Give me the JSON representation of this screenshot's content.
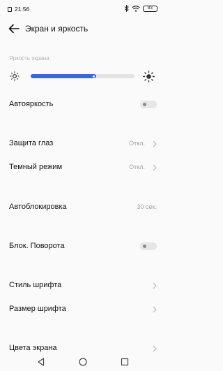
{
  "status_bar": {
    "time": "21:56",
    "battery": "83",
    "icons": [
      "bluetooth-icon",
      "wifi-icon",
      "battery-icon"
    ]
  },
  "header": {
    "title": "Экран и яркость",
    "back_icon": "arrow-left-icon"
  },
  "brightness": {
    "section_label": "Яркость экрана",
    "level_percent": 63,
    "accent_color": "#3b63e6"
  },
  "settings": {
    "auto_brightness": {
      "label": "Автояркость",
      "enabled": false
    },
    "eye_protection": {
      "label": "Защита глаз",
      "value": "Откл."
    },
    "dark_mode": {
      "label": "Темный режим",
      "value": "Откл."
    },
    "auto_lock": {
      "label": "Автоблокировка",
      "value": "30 сек."
    },
    "rotation_lock": {
      "label": "Блок. Поворота",
      "enabled": false
    },
    "font_style": {
      "label": "Стиль шрифта"
    },
    "font_size": {
      "label": "Размер шрифта"
    },
    "screen_colors": {
      "label": "Цвета экрана"
    }
  },
  "nav_bar": {
    "icons": [
      "back-triangle-icon",
      "home-circle-icon",
      "recents-square-icon"
    ]
  }
}
